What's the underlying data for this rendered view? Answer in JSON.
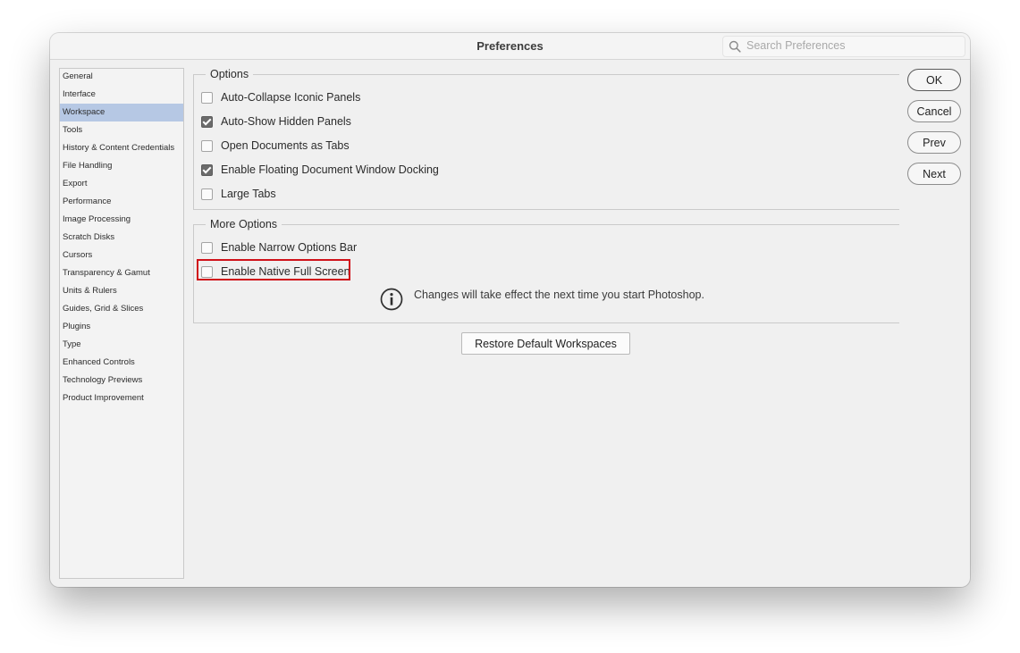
{
  "window": {
    "title": "Preferences"
  },
  "search": {
    "placeholder": "Search Preferences",
    "value": ""
  },
  "sidebar": {
    "selected": "Workspace",
    "items": [
      {
        "label": "General"
      },
      {
        "label": "Interface"
      },
      {
        "label": "Workspace"
      },
      {
        "label": "Tools"
      },
      {
        "label": "History & Content Credentials"
      },
      {
        "label": "File Handling"
      },
      {
        "label": "Export"
      },
      {
        "label": "Performance"
      },
      {
        "label": "Image Processing"
      },
      {
        "label": "Scratch Disks"
      },
      {
        "label": "Cursors"
      },
      {
        "label": "Transparency & Gamut"
      },
      {
        "label": "Units & Rulers"
      },
      {
        "label": "Guides, Grid & Slices"
      },
      {
        "label": "Plugins"
      },
      {
        "label": "Type"
      },
      {
        "label": "Enhanced Controls"
      },
      {
        "label": "Technology Previews"
      },
      {
        "label": "Product Improvement"
      }
    ]
  },
  "options": {
    "legend": "Options",
    "items": [
      {
        "label": "Auto-Collapse Iconic Panels",
        "checked": false
      },
      {
        "label": "Auto-Show Hidden Panels",
        "checked": true
      },
      {
        "label": "Open Documents as Tabs",
        "checked": false
      },
      {
        "label": "Enable Floating Document Window Docking",
        "checked": true
      },
      {
        "label": "Large Tabs",
        "checked": false
      }
    ]
  },
  "more_options": {
    "legend": "More Options",
    "items": [
      {
        "label": "Enable Narrow Options Bar",
        "checked": false
      },
      {
        "label": "Enable Native Full Screen",
        "checked": false
      }
    ],
    "info_text": "Changes will take effect the next time you start Photoshop."
  },
  "restore_button": {
    "label": "Restore Default Workspaces"
  },
  "buttons": {
    "ok": "OK",
    "cancel": "Cancel",
    "prev": "Prev",
    "next": "Next"
  },
  "colors": {
    "selection": "#b6c8e4",
    "highlight": "#d0121a",
    "window_bg": "#f0f0f0"
  },
  "icons": {
    "search": "magnifier-icon",
    "info": "info-circle-icon"
  }
}
